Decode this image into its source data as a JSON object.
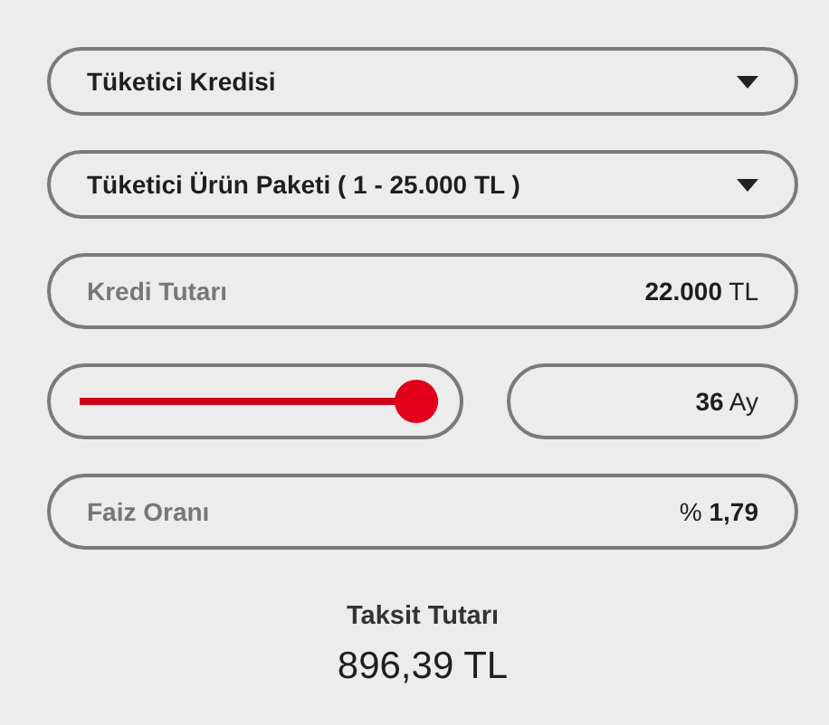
{
  "selects": [
    {
      "value": "Tüketici Kredisi"
    },
    {
      "value": "Tüketici Ürün Paketi ( 1 - 25.000 TL )"
    }
  ],
  "amount": {
    "label": "Kredi Tutarı",
    "value": "**22.000** TL"
  },
  "term": {
    "level": 1,
    "value": "**36** Ay"
  },
  "rate": {
    "label": "Faiz Oranı",
    "value": "% **1,79**"
  },
  "result": {
    "label": "Taksit Tutarı",
    "value": "896,39 TL"
  }
}
